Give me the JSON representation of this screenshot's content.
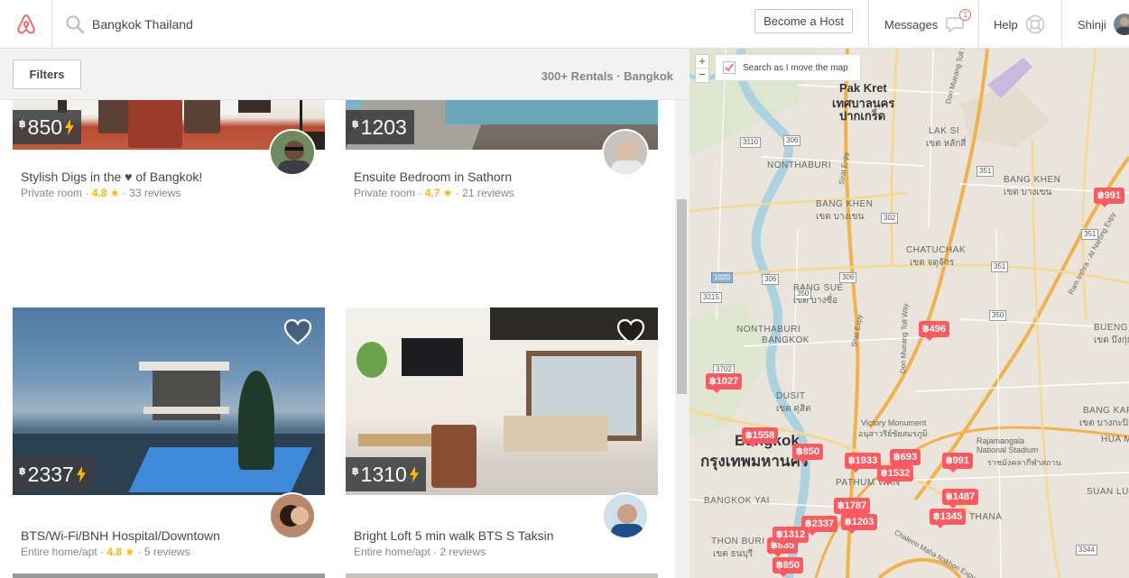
{
  "header": {
    "search_value": "Bangkok Thailand",
    "become_host": "Become a Host",
    "messages": "Messages",
    "messages_badge": "1",
    "help": "Help",
    "user": "Shinji",
    "brand_color": "#ff5a5f"
  },
  "filters": {
    "button": "Filters",
    "results": "300+ Rentals · Bangkok"
  },
  "listings": [
    {
      "price": "850",
      "currency": "฿",
      "title": "Stylish Digs in the ♥ of Bangkok!",
      "type": "Private room",
      "rating": "4.8 ★",
      "reviews": "33 reviews",
      "instant": true
    },
    {
      "price": "1203",
      "currency": "฿",
      "title": "Ensuite Bedroom in Sathorn",
      "type": "Private room",
      "rating": "4.7 ★",
      "reviews": "21 reviews",
      "instant": false
    },
    {
      "price": "2337",
      "currency": "฿",
      "title": "BTS/Wi-Fi/BNH Hospital/Downtown",
      "type": "Entire home/apt",
      "rating": "4.8 ★",
      "reviews": "5 reviews",
      "instant": true
    },
    {
      "price": "1310",
      "currency": "฿",
      "title": "Bright Loft 5 min walk BTS S Taksin",
      "type": "Entire home/apt",
      "rating": "",
      "reviews": "2 reviews",
      "instant": true
    }
  ],
  "map": {
    "zoom_in": "+",
    "zoom_out": "−",
    "search_as_move": "Search as I move the map",
    "pins": [
      "฿991",
      "฿496",
      "฿1027",
      "฿1558",
      "฿850",
      "฿1933",
      "฿693",
      "฿1532",
      "฿991",
      "฿1487",
      "฿1787",
      "฿2337",
      "฿1345",
      "฿885",
      "฿850",
      "฿1312",
      "฿1203"
    ],
    "labels": [
      "Pak Kret",
      "เทศบาลนคร",
      "ปากเกร็ด",
      "LAK SI",
      "เขต หลักสี่",
      "NONTHABURI",
      "BANG KHEN",
      "เขต บางเขน",
      "BANG KHEN",
      "เขต บางเขน",
      "CHATUCHAK",
      "เขต จตุจักร",
      "BANG SUE",
      "เขต บางซื่อ",
      "NONTHABURI",
      "BANGKOK",
      "DUSIT",
      "เขต ดุสิต",
      "Bangkok",
      "กรุงเทพมหานคร",
      "Victory Monument",
      "อนุสาวรีย์ชัยสมรภูมิ",
      "Rajamangala National Stadium",
      "ราชมังคลากีฬาสถาน",
      "PATHUM WAN",
      "BANG KAPI",
      "เขต บางกะปิ",
      "HUA MA",
      "BUENG KU",
      "เขต บึงกุ่ม",
      "BANGKOK YAI",
      "THON BURI",
      "เขต ธนบุรี",
      "SUAN LUANG",
      "THANA"
    ],
    "roads": [
      "Don Mueang Toll Way",
      "Sirat Expy",
      "Ram Inthra - At Narong Expy",
      "Chalerm Maha Nakhon Expy",
      "Don Mueang Toll Way",
      "Sirat Expy"
    ],
    "route_numbers": [
      "306",
      "3110",
      "302",
      "351",
      "1020",
      "3215",
      "306",
      "350",
      "3344",
      "351",
      "350",
      "306",
      "351",
      "3702"
    ]
  }
}
